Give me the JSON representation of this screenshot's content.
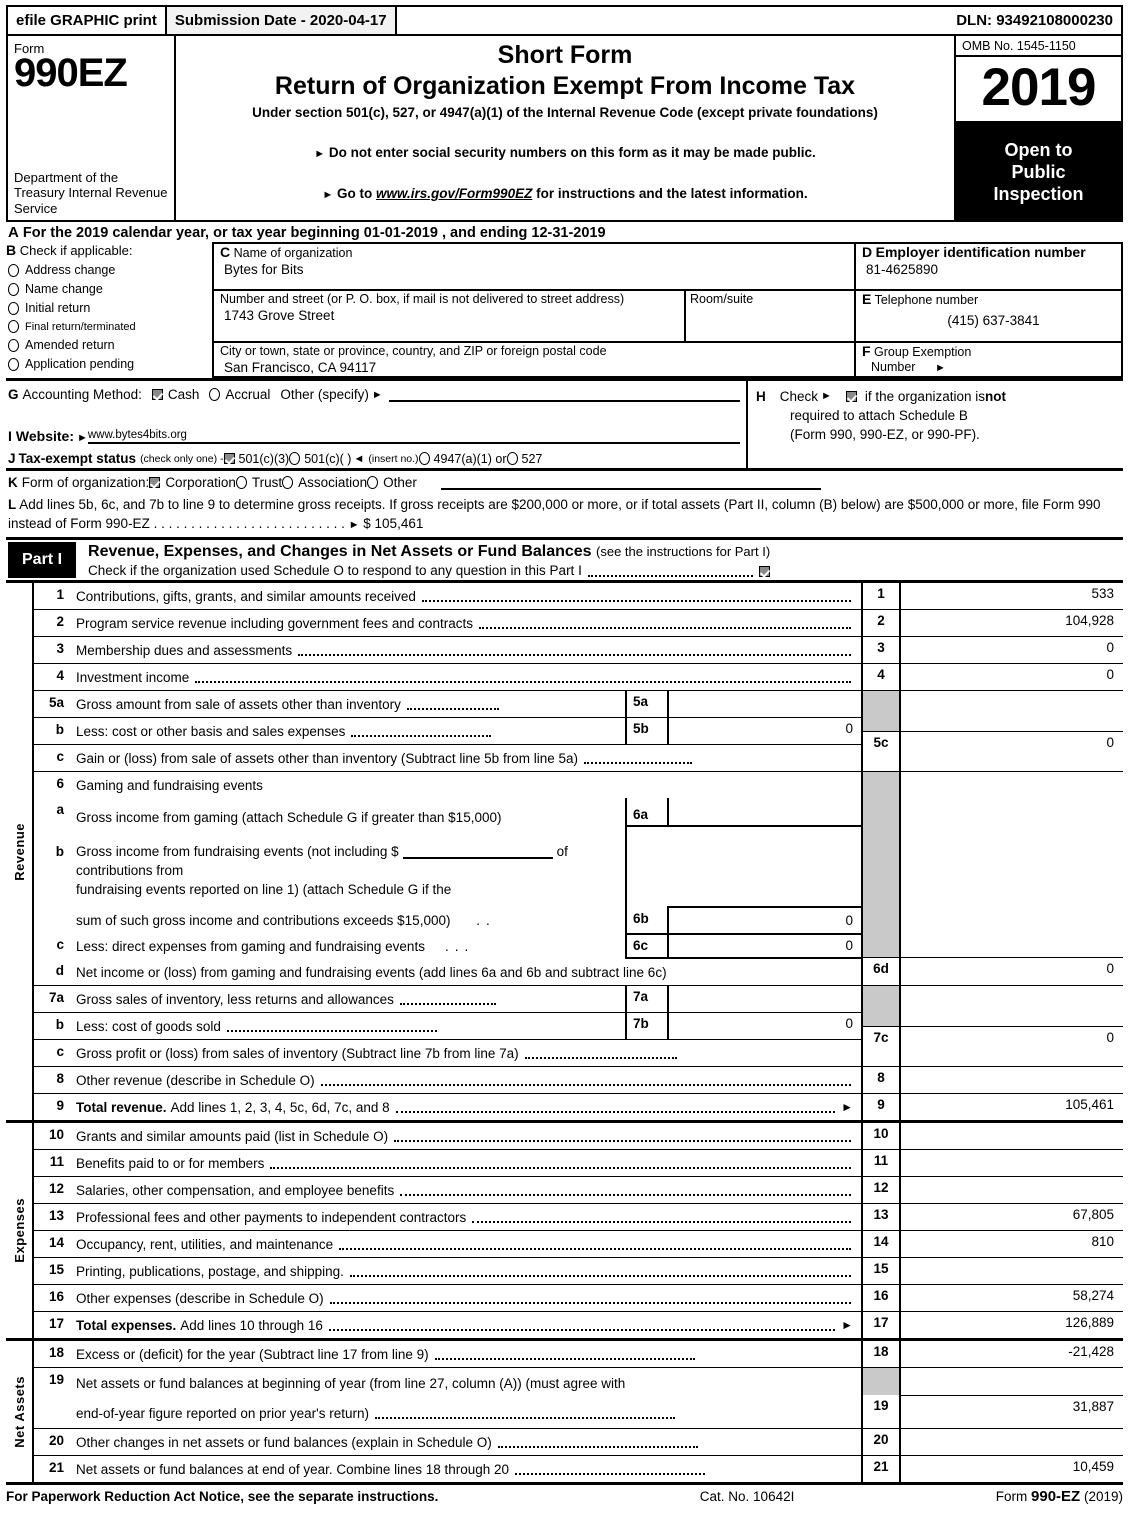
{
  "efile": {
    "graphic_print": "efile GRAPHIC print",
    "submission_date": "Submission Date - 2020-04-17",
    "dln": "DLN: 93492108000230"
  },
  "masthead": {
    "form_word": "Form",
    "form_number": "990EZ",
    "department": "Department of the Treasury Internal Revenue Service",
    "title_line1": "Short Form",
    "title_line2": "Return of Organization Exempt From Income Tax",
    "subtitle": "Under section 501(c), 527, or 4947(a)(1) of the Internal Revenue Code (except private foundations)",
    "bullet1": "Do not enter social security numbers on this form as it may be made public.",
    "bullet2_pre": "Go to ",
    "bullet2_link": "www.irs.gov/Form990EZ",
    "bullet2_post": " for instructions and the latest information.",
    "omb": "OMB No. 1545-1150",
    "year": "2019",
    "open_to": "Open to",
    "public": "Public",
    "inspection": "Inspection"
  },
  "lineA": {
    "letter": "A",
    "text": "For the 2019 calendar year, or tax year beginning 01-01-2019 , and ending 12-31-2019"
  },
  "blockB": {
    "letter": "B",
    "header": "Check if applicable:",
    "items": [
      {
        "label": "Address change",
        "checked": false
      },
      {
        "label": "Name change",
        "checked": false
      },
      {
        "label": "Initial return",
        "checked": false
      },
      {
        "label": "Final return/terminated",
        "checked": false,
        "small": true
      },
      {
        "label": "Amended return",
        "checked": false
      },
      {
        "label": "Application pending",
        "checked": false
      }
    ]
  },
  "blockC": {
    "letter": "C",
    "name_label": "Name of organization",
    "name_value": "Bytes for Bits",
    "street_label": "Number and street (or P. O. box, if mail is not delivered to street address)",
    "street_value": "1743 Grove Street",
    "room_label": "Room/suite",
    "room_value": "",
    "city_label": "City or town, state or province, country, and ZIP or foreign postal code",
    "city_value": "San Francisco, CA  94117"
  },
  "blockD": {
    "letter": "D",
    "label": "Employer identification number",
    "value": "81-4625890"
  },
  "blockE": {
    "letter": "E",
    "label": "Telephone number",
    "value": "(415) 637-3841"
  },
  "blockF": {
    "letter": "F",
    "label_line1": "Group Exemption",
    "label_line2": "Number"
  },
  "blockG": {
    "letter": "G",
    "label": "Accounting Method:",
    "cash": "Cash",
    "cash_checked": true,
    "accrual": "Accrual",
    "accrual_checked": false,
    "other": "Other (specify)"
  },
  "blockH": {
    "letter": "H",
    "check_label": "Check",
    "checked": true,
    "text1_pre": "if the organization is ",
    "text1_bold": "not",
    "text2": "required to attach Schedule B",
    "text3": "(Form 990, 990-EZ, or 990-PF)."
  },
  "blockI": {
    "letter": "I",
    "label": "Website:",
    "value": "www.bytes4bits.org"
  },
  "blockJ": {
    "letter": "J",
    "label": "Tax-exempt status",
    "note": "(check only one) -",
    "options": [
      {
        "label": "501(c)(3)",
        "checked": true
      },
      {
        "label": "501(c)(    )",
        "checked": false
      },
      {
        "label": "4947(a)(1) or",
        "checked": false
      },
      {
        "label": "527",
        "checked": false
      }
    ],
    "insert_no": "(insert no.)"
  },
  "blockK": {
    "letter": "K",
    "label": "Form of organization:",
    "options": [
      {
        "label": "Corporation",
        "checked": true
      },
      {
        "label": "Trust",
        "checked": false
      },
      {
        "label": "Association",
        "checked": false
      },
      {
        "label": "Other",
        "checked": false
      }
    ]
  },
  "blockL": {
    "letter": "L",
    "text": "Add lines 5b, 6c, and 7b to line 9 to determine gross receipts. If gross receipts are $200,000 or more, or if total assets (Part II, column (B) below) are $500,000 or more, file Form 990 instead of Form 990-EZ",
    "amount": "$ 105,461"
  },
  "partI": {
    "tag": "Part I",
    "title": "Revenue, Expenses, and Changes in Net Assets or Fund Balances",
    "title_note": "(see the instructions for Part I)",
    "schedule_o_text": "Check if the organization used Schedule O to respond to any question in this Part I",
    "schedule_o_checked": true
  },
  "sections": {
    "revenue_label": "Revenue",
    "expenses_label": "Expenses",
    "net_assets_label": "Net Assets"
  },
  "revenue_rows": [
    {
      "num": "1",
      "text": "Contributions, gifts, grants, and similar amounts received",
      "code": "1",
      "value": "533"
    },
    {
      "num": "2",
      "text": "Program service revenue including government fees and contracts",
      "code": "2",
      "value": "104,928"
    },
    {
      "num": "3",
      "text": "Membership dues and assessments",
      "code": "3",
      "value": "0"
    },
    {
      "num": "4",
      "text": "Investment income",
      "code": "4",
      "value": "0"
    },
    {
      "num": "5a",
      "text": "Gross amount from sale of assets other than inventory",
      "inner_code": "5a",
      "inner_value": ""
    },
    {
      "num": "b",
      "text": "Less: cost or other basis and sales expenses",
      "inner_code": "5b",
      "inner_value": "0"
    },
    {
      "num": "c",
      "text": "Gain or (loss) from sale of assets other than inventory (Subtract line 5b from line 5a)",
      "code": "5c",
      "value": "0"
    },
    {
      "num": "6",
      "text": "Gaming and fundraising events"
    },
    {
      "num": "a",
      "text": "Gross income from gaming (attach Schedule G if greater than $15,000)",
      "inner_code": "6a",
      "inner_value": ""
    },
    {
      "num": "b",
      "text_l1_pre": "Gross income from fundraising events (not including $",
      "text_l1_post": "of contributions from",
      "text_l2": "fundraising events reported on line 1) (attach Schedule G if the",
      "text_l3": "sum of such gross income and contributions exceeds $15,000)",
      "inner_code": "6b",
      "inner_value": "0"
    },
    {
      "num": "c",
      "text": "Less: direct expenses from gaming and fundraising events",
      "inner_code": "6c",
      "inner_value": "0"
    },
    {
      "num": "d",
      "text": "Net income or (loss) from gaming and fundraising events (add lines 6a and 6b and subtract line 6c)",
      "code": "6d",
      "value": "0"
    },
    {
      "num": "7a",
      "text": "Gross sales of inventory, less returns and allowances",
      "inner_code": "7a",
      "inner_value": ""
    },
    {
      "num": "b",
      "text": "Less: cost of goods sold",
      "inner_code": "7b",
      "inner_value": "0"
    },
    {
      "num": "c",
      "text": "Gross profit or (loss) from sales of inventory (Subtract line 7b from line 7a)",
      "code": "7c",
      "value": "0"
    },
    {
      "num": "8",
      "text": "Other revenue (describe in Schedule O)",
      "code": "8",
      "value": ""
    },
    {
      "num": "9",
      "text_bold": "Total revenue.",
      "text": "Add lines 1, 2, 3, 4, 5c, 6d, 7c, and 8",
      "code": "9",
      "value": "105,461",
      "arrow": true
    }
  ],
  "expense_rows": [
    {
      "num": "10",
      "text": "Grants and similar amounts paid (list in Schedule O)",
      "code": "10",
      "value": ""
    },
    {
      "num": "11",
      "text": "Benefits paid to or for members",
      "code": "11",
      "value": ""
    },
    {
      "num": "12",
      "text": "Salaries, other compensation, and employee benefits",
      "code": "12",
      "value": ""
    },
    {
      "num": "13",
      "text": "Professional fees and other payments to independent contractors",
      "code": "13",
      "value": "67,805"
    },
    {
      "num": "14",
      "text": "Occupancy, rent, utilities, and maintenance",
      "code": "14",
      "value": "810"
    },
    {
      "num": "15",
      "text": "Printing, publications, postage, and shipping.",
      "code": "15",
      "value": ""
    },
    {
      "num": "16",
      "text": "Other expenses (describe in Schedule O)",
      "code": "16",
      "value": "58,274"
    },
    {
      "num": "17",
      "text_bold": "Total expenses.",
      "text": "Add lines 10 through 16",
      "code": "17",
      "value": "126,889",
      "arrow": true
    }
  ],
  "net_asset_rows": [
    {
      "num": "18",
      "text": "Excess or (deficit) for the year (Subtract line 17 from line 9)",
      "code": "18",
      "value": "-21,428"
    },
    {
      "num": "19",
      "text_l1": "Net assets or fund balances at beginning of year (from line 27, column (A)) (must agree with",
      "text_l2": "end-of-year figure reported on prior year's return)",
      "code": "19",
      "value": "31,887"
    },
    {
      "num": "20",
      "text": "Other changes in net assets or fund balances (explain in Schedule O)",
      "code": "20",
      "value": ""
    },
    {
      "num": "21",
      "text": "Net assets or fund balances at end of year. Combine lines 18 through 20",
      "code": "21",
      "value": "10,459"
    }
  ],
  "footer": {
    "left": "For Paperwork Reduction Act Notice, see the separate instructions.",
    "cat": "Cat. No. 10642I",
    "form_pre": "Form ",
    "form_bold": "990-EZ",
    "form_post": " (2019)"
  }
}
